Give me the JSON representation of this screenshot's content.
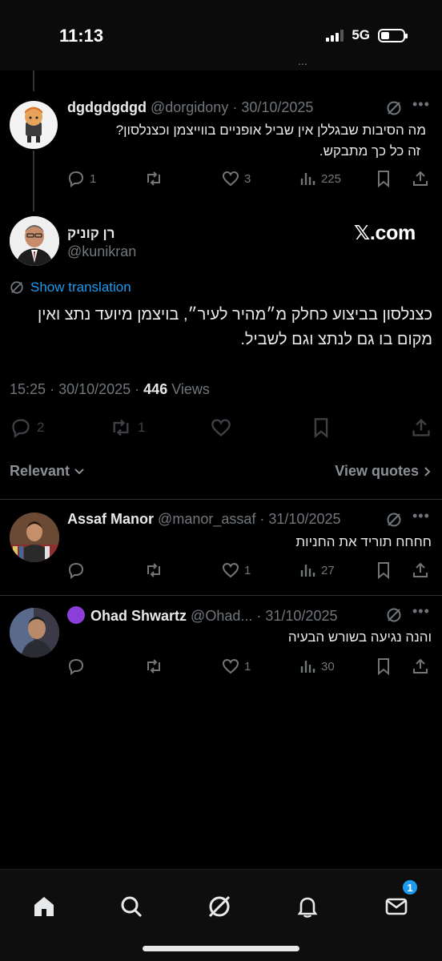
{
  "status_bar": {
    "time": "11:13",
    "network": "5G"
  },
  "top_header": {
    "ghost_dots": "..."
  },
  "reply_top": {
    "name": "dgdgdgdgd",
    "handle": "@dorgidony",
    "date": "30/10/2025",
    "text_line1": "מה הסיבות שבגללן אין שביל אופניים בווייצמן וכצנלסון?",
    "text_line2": "זה כל כך מתבקש.",
    "replies": "1",
    "likes": "3",
    "views": "225"
  },
  "main_post": {
    "name": "רן קוניק",
    "handle": "@kunikran",
    "source_watermark": "𝕏.com",
    "show_translation": "Show translation",
    "text": "כצנלסון בביצוע כחלק מ״מהיר לעיר״, בויצמן מיועד נתצ ואין מקום בו גם לנתצ וגם לשביל.",
    "time": "15:25",
    "date": "30/10/2025",
    "views_count": "446",
    "views_label": "Views",
    "replies": "2",
    "reposts": "1"
  },
  "sort": {
    "relevant_label": "Relevant",
    "view_quotes_label": "View quotes"
  },
  "replies": [
    {
      "name": "Assaf Manor",
      "handle": "@manor_assaf",
      "date": "31/10/2025",
      "text": "חחחח תוריד את החניות",
      "likes": "1",
      "views": "27"
    },
    {
      "name": "Ohad Shwartz",
      "handle": "@Ohad...",
      "date": "31/10/2025",
      "text": "והנה נגיעה בשורש הבעיה",
      "likes": "1",
      "views": "30"
    }
  ],
  "bottom_nav": {
    "messages_badge": "1"
  },
  "icons": {
    "reply": "reply-icon",
    "repost": "repost-icon",
    "like": "heart-icon",
    "views": "views-chart-icon",
    "bookmark": "bookmark-icon",
    "share": "share-icon",
    "grok": "grok-icon",
    "more": "more-icon"
  },
  "colors": {
    "accent": "#1d9bf0",
    "muted": "#71767b",
    "text": "#e7e9ea",
    "background": "#000000"
  }
}
